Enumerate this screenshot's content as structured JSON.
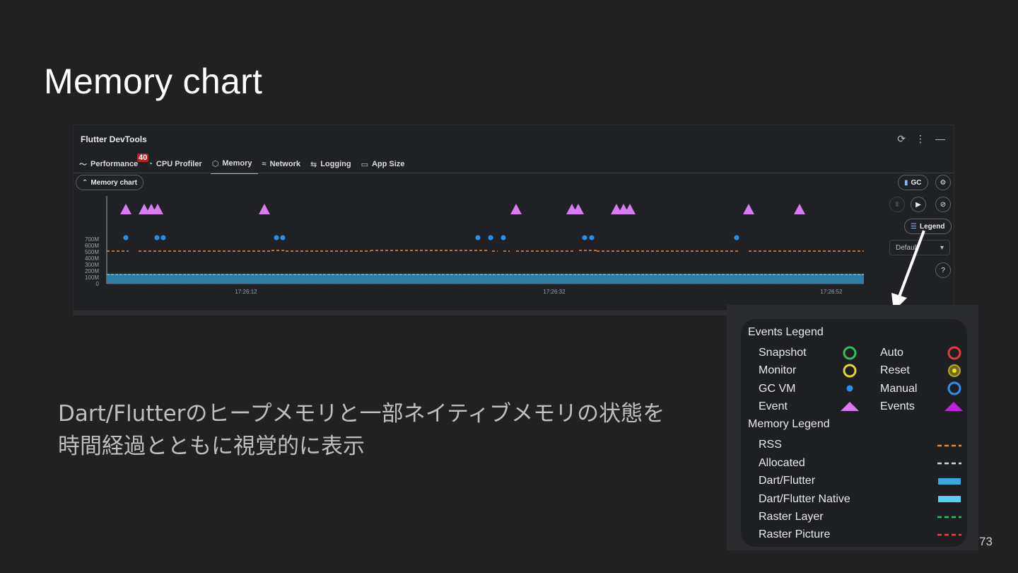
{
  "slide": {
    "title": "Memory chart",
    "description_line1": "Dart/Flutterのヒープメモリと一部ネイティブメモリの状態を",
    "description_line2": "時間経過とともに視覚的に表示",
    "page_number": "73"
  },
  "devtools": {
    "window_title": "Flutter DevTools",
    "tabs": [
      {
        "label": "Performance",
        "icon": "performance-icon"
      },
      {
        "label": "CPU Profiler",
        "icon": "cpu-profiler-icon"
      },
      {
        "label": "Memory",
        "icon": "memory-icon",
        "active": true
      },
      {
        "label": "Network",
        "icon": "network-icon"
      },
      {
        "label": "Logging",
        "icon": "logging-icon"
      },
      {
        "label": "App Size",
        "icon": "app-size-icon"
      }
    ],
    "badge_count": "40",
    "memory_chart_toggle": "Memory chart",
    "gc_button": "GC",
    "legend_button": "Legend",
    "interval_dropdown": "Default",
    "y_ticks": [
      "700M",
      "600M",
      "500M",
      "400M",
      "300M",
      "200M",
      "100M",
      "0"
    ],
    "x_ticks": [
      "17:26:12",
      "17:26:32",
      "17:26:52"
    ],
    "colors": {
      "rss": "#ef8a3e",
      "dart_heap": "#3a8fb7",
      "event": "#d97cf2",
      "gc_vm": "#2f8fe8",
      "accent_tab": "#8ab4f8"
    }
  },
  "legend": {
    "events_title": "Events Legend",
    "memory_title": "Memory Legend",
    "events_left": [
      {
        "label": "Snapshot",
        "symbol": "green-ring"
      },
      {
        "label": "Monitor",
        "symbol": "yellow-ring"
      },
      {
        "label": "GC VM",
        "symbol": "blue-dot"
      },
      {
        "label": "Event",
        "symbol": "pink-triangle"
      }
    ],
    "events_right": [
      {
        "label": "Auto",
        "symbol": "red-ring"
      },
      {
        "label": "Reset",
        "symbol": "yellow-dot-ring"
      },
      {
        "label": "Manual",
        "symbol": "blue-ring"
      },
      {
        "label": "Events",
        "symbol": "purple-triangle"
      }
    ],
    "memory": [
      {
        "label": "RSS",
        "style": "dashed",
        "color": "#ef8a3e"
      },
      {
        "label": "Allocated",
        "style": "dashed",
        "color": "#d0d4da"
      },
      {
        "label": "Dart/Flutter",
        "style": "solid",
        "color": "#3aa7e0"
      },
      {
        "label": "Dart/Flutter Native",
        "style": "solid",
        "color": "#56d0f5"
      },
      {
        "label": "Raster Layer",
        "style": "dashed",
        "color": "#2fc15b"
      },
      {
        "label": "Raster Picture",
        "style": "dashed",
        "color": "#e8453c"
      }
    ]
  }
}
